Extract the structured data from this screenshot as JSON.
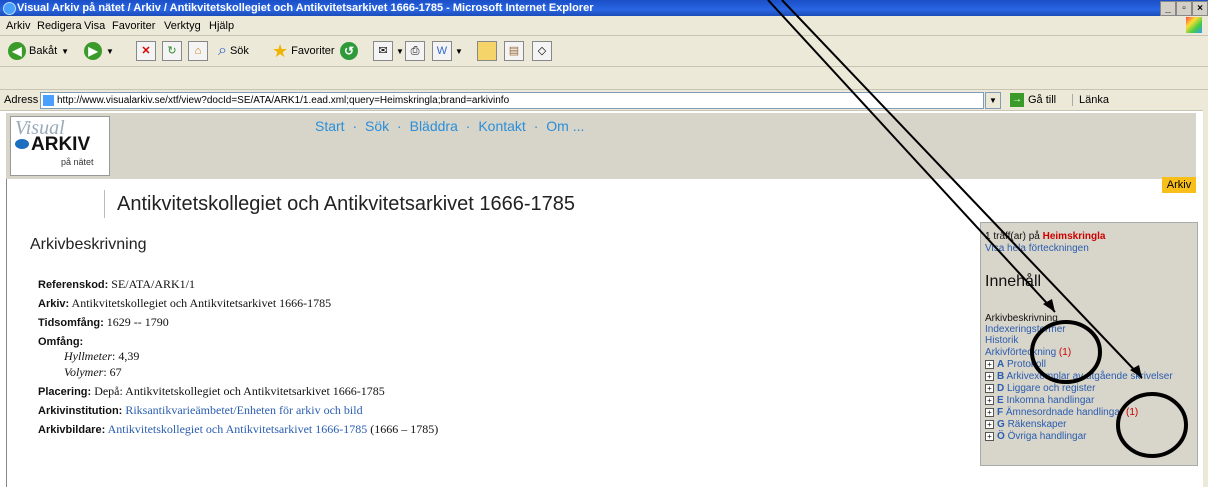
{
  "window": {
    "title": "Visual Arkiv på nätet / Arkiv / Antikvitetskollegiet och Antikvitetsarkivet 1666-1785 - Microsoft Internet Explorer",
    "controls": [
      "_",
      "▫",
      "×"
    ]
  },
  "menu": [
    "Arkiv",
    "Redigera",
    "Visa",
    "Favoriter",
    "Verktyg",
    "Hjälp"
  ],
  "toolbar": {
    "back_label": "Bakåt",
    "search_label": "Sök",
    "favorites_label": "Favoriter"
  },
  "address": {
    "label": "Adress",
    "url": "http://www.visualarkiv.se/xtf/view?docId=SE/ATA/ARK1/1.ead.xml;query=Heimskringla;brand=arkivinfo",
    "go_label": "Gå till",
    "links_label": "Länka"
  },
  "site": {
    "logo_word1": "Visual",
    "logo_word2": "ARKIV",
    "logo_word3": "på nätet",
    "nav": [
      "Start",
      "·",
      "Sök",
      "·",
      "Bläddra",
      "·",
      "Kontakt",
      "·",
      "Om ..."
    ],
    "tab": "Arkiv"
  },
  "page": {
    "title": "Antikvitetskollegiet och Antikvitetsarkivet 1666-1785",
    "section": "Arkivbeskrivning",
    "fields": {
      "ref_label": "Referenskod:",
      "ref_value": "SE/ATA/ARK1/1",
      "arkiv_label": "Arkiv:",
      "arkiv_value": "Antikvitetskollegiet och Antikvitetsarkivet 1666-1785",
      "tid_label": "Tidsomfång:",
      "tid_value": "1629 -- 1790",
      "omf_label": "Omfång:",
      "hyll_label": "Hyllmeter",
      "hyll_value": ": 4,39",
      "vol_label": "Volymer",
      "vol_value": ": 67",
      "plac_label": "Placering:",
      "plac_value": "Depå: Antikvitetskollegiet och Antikvitetsarkivet 1666-1785",
      "inst_label": "Arkivinstitution:",
      "inst_value": "Riksantikvarieämbetet/Enheten för arkiv och bild",
      "bild_label": "Arkivbildare:",
      "bild_value": "Antikvitetskollegiet och Antikvitetsarkivet 1666-1785",
      "bild_years": "(1666 – 1785)"
    }
  },
  "sidebox": {
    "hits_prefix": "1 träff(ar) på",
    "hits_query": "Heimskringla",
    "show_all": "Visa hela förteckningen",
    "heading": "Innehåll",
    "items": [
      {
        "text": "Arkivbeskrivning",
        "link": false
      },
      {
        "text": "Indexeringstermer",
        "link": true
      },
      {
        "text": "Historik",
        "link": true
      },
      {
        "text": "Arkivförteckning",
        "link": true,
        "count": "(1)"
      }
    ],
    "series": [
      {
        "code": "A",
        "text": "Protokoll"
      },
      {
        "code": "B",
        "text": "Arkivexemplar av utgående skrivelser"
      },
      {
        "code": "D",
        "text": "Liggare och register"
      },
      {
        "code": "E",
        "text": "Inkomna handlingar"
      },
      {
        "code": "F",
        "text": "Ämnesordnade handlingar",
        "count": "(1)"
      },
      {
        "code": "G",
        "text": "Räkenskaper"
      },
      {
        "code": "Ö",
        "text": "Övriga handlingar"
      }
    ]
  }
}
